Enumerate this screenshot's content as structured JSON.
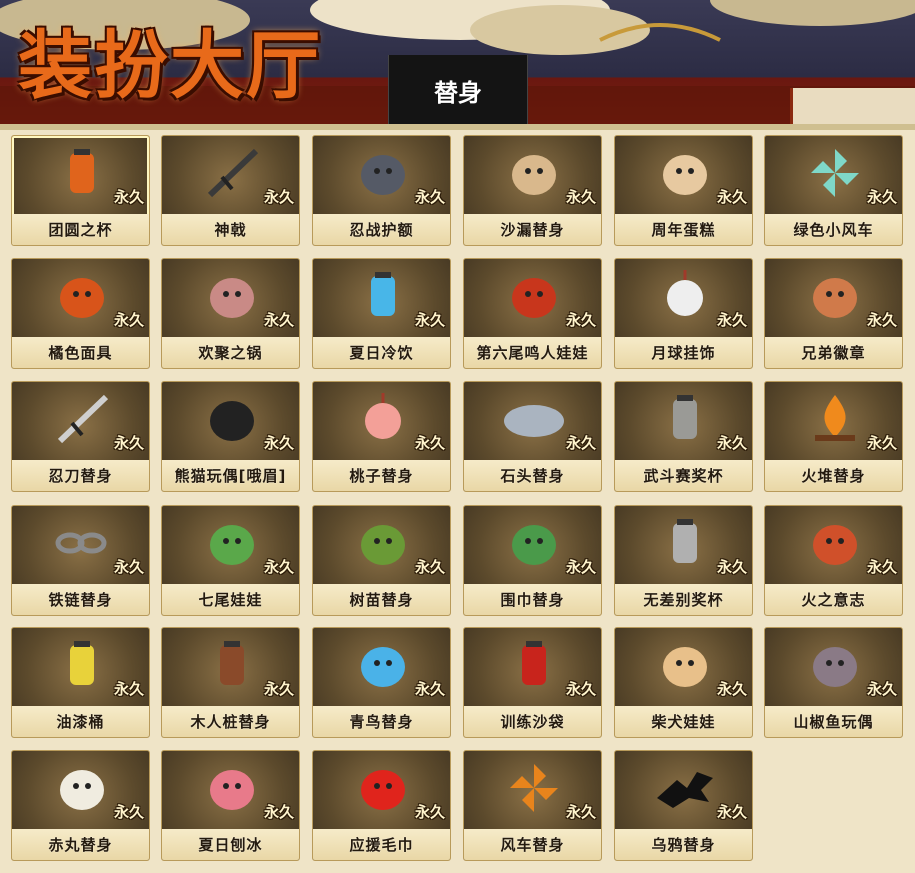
{
  "header": {
    "title": "装扮大厅",
    "active_tab": "替身"
  },
  "permanent_label": "永久",
  "items": [
    {
      "name": "团圆之杯",
      "icon": "orange-drink-cup-icon",
      "color": "#e0641c"
    },
    {
      "name": "神戟",
      "icon": "halberd-icon",
      "color": "#3a3a3a"
    },
    {
      "name": "忍战护额",
      "icon": "forehead-protector-icon",
      "color": "#555a66"
    },
    {
      "name": "沙漏替身",
      "icon": "hourglass-icon",
      "color": "#d9b88c"
    },
    {
      "name": "周年蛋糕",
      "icon": "cake-icon",
      "color": "#e7c9a0"
    },
    {
      "name": "绿色小风车",
      "icon": "pinwheel-icon",
      "color": "#7fd8c8"
    },
    {
      "name": "橘色面具",
      "icon": "orange-mask-icon",
      "color": "#d8541a"
    },
    {
      "name": "欢聚之锅",
      "icon": "pot-icon",
      "color": "#c98a86"
    },
    {
      "name": "夏日冷饮",
      "icon": "cold-drink-icon",
      "color": "#48b6e8"
    },
    {
      "name": "第六尾鸣人娃娃",
      "icon": "fox-doll-icon",
      "color": "#c8361c"
    },
    {
      "name": "月球挂饰",
      "icon": "moon-charm-icon",
      "color": "#eeeeee"
    },
    {
      "name": "兄弟徽章",
      "icon": "badge-icon",
      "color": "#d07a4a"
    },
    {
      "name": "忍刀替身",
      "icon": "ninja-sword-icon",
      "color": "#cfcfcf"
    },
    {
      "name": "熊猫玩偶[哦眉]",
      "icon": "panda-doll-icon",
      "color": "#222222"
    },
    {
      "name": "桃子替身",
      "icon": "peach-icon",
      "color": "#f3a098"
    },
    {
      "name": "石头替身",
      "icon": "stone-icon",
      "color": "#aab4c0"
    },
    {
      "name": "武斗赛奖杯",
      "icon": "trophy-icon",
      "color": "#9a9a96"
    },
    {
      "name": "火堆替身",
      "icon": "campfire-icon",
      "color": "#f08a1c"
    },
    {
      "name": "铁链替身",
      "icon": "chain-icon",
      "color": "#8a8a8a"
    },
    {
      "name": "七尾娃娃",
      "icon": "green-larva-icon",
      "color": "#5aa84a"
    },
    {
      "name": "树苗替身",
      "icon": "sapling-icon",
      "color": "#6a9a36"
    },
    {
      "name": "围巾替身",
      "icon": "scarf-icon",
      "color": "#4a9a4a"
    },
    {
      "name": "无差别奖杯",
      "icon": "silver-trophy-icon",
      "color": "#b0b0b0"
    },
    {
      "name": "火之意志",
      "icon": "fire-will-icon",
      "color": "#d0502a"
    },
    {
      "name": "油漆桶",
      "icon": "paint-bucket-icon",
      "color": "#e8d23a"
    },
    {
      "name": "木人桩替身",
      "icon": "wooden-dummy-icon",
      "color": "#8a4a2a"
    },
    {
      "name": "青鸟替身",
      "icon": "blue-bird-icon",
      "color": "#4ab2e8"
    },
    {
      "name": "训练沙袋",
      "icon": "punching-bag-icon",
      "color": "#c8241c"
    },
    {
      "name": "柴犬娃娃",
      "icon": "shiba-doll-icon",
      "color": "#e8c08a"
    },
    {
      "name": "山椒鱼玩偶",
      "icon": "salamander-doll-icon",
      "color": "#8a7a86"
    },
    {
      "name": "赤丸替身",
      "icon": "white-dog-icon",
      "color": "#f0ece0"
    },
    {
      "name": "夏日刨冰",
      "icon": "shaved-ice-icon",
      "color": "#e87a8a"
    },
    {
      "name": "应援毛巾",
      "icon": "cheer-towel-icon",
      "color": "#e0241c"
    },
    {
      "name": "风车替身",
      "icon": "windmill-icon",
      "color": "#e8841c"
    },
    {
      "name": "乌鸦替身",
      "icon": "crow-icon",
      "color": "#111111"
    }
  ]
}
